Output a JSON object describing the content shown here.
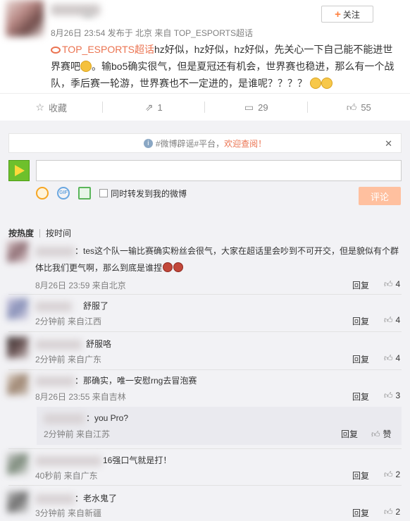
{
  "post": {
    "follow_label": "关注",
    "meta": "8月26日 23:54 发布于 北京 来自 TOP_ESPORTS超话",
    "link_text": "TOP_ESPORTS超话",
    "text_line1": "hz好似，hz好似，hz好似，先关心一下自己能不能进世",
    "text_line2": "界赛吧",
    "text_line3": "。输bo5确实很气，但是夏冠还有机会，世界赛也稳进，那么有一个战",
    "text_line4": "队，季后赛一轮游，世界赛也不一定进的，是谁呢？？？？"
  },
  "actions": [
    {
      "icon": "star-icon",
      "label": "收藏"
    },
    {
      "icon": "share-icon",
      "label": "1"
    },
    {
      "icon": "comment-icon",
      "label": "29"
    },
    {
      "icon": "thumb-up-icon",
      "label": "55"
    }
  ],
  "notice": {
    "text": "#微博辟谣#平台，",
    "link": "欢迎查阅！"
  },
  "compose": {
    "forward_label": "同时转发到我的微博",
    "submit_label": "评论"
  },
  "sort": {
    "hot": "按热度",
    "time": "按时间"
  },
  "comments": [
    {
      "text": "：tes这个队一输比赛确实粉丝会很气，大家在超话里会吵到不可开交，但是貌似有个群",
      "text2": "体比我们更气啊，那么到底是谁捏",
      "meta": "8月26日 23:59 来自北京",
      "reply": "回复",
      "likes": "4"
    },
    {
      "text": "舒服了",
      "meta": "2分钟前 来自江西",
      "reply": "回复",
      "likes": "4"
    },
    {
      "text": "舒服咯",
      "meta": "2分钟前 来自广东",
      "reply": "回复",
      "likes": "4"
    },
    {
      "text": "：那确实，唯一安慰rng去冒泡赛",
      "meta": "8月26日 23:55 来自吉林",
      "reply": "回复",
      "likes": "3"
    },
    {
      "text": "：you Pro?",
      "meta": "2分钟前 来自江苏",
      "reply": "回复",
      "likes": "赞"
    },
    {
      "text": "16强口气就是打！",
      "meta": "40秒前 来自广东",
      "reply": "回复",
      "likes": "2"
    },
    {
      "text": "：老水鬼了",
      "meta": "3分钟前 来自新疆",
      "reply": "回复",
      "likes": "2"
    }
  ]
}
